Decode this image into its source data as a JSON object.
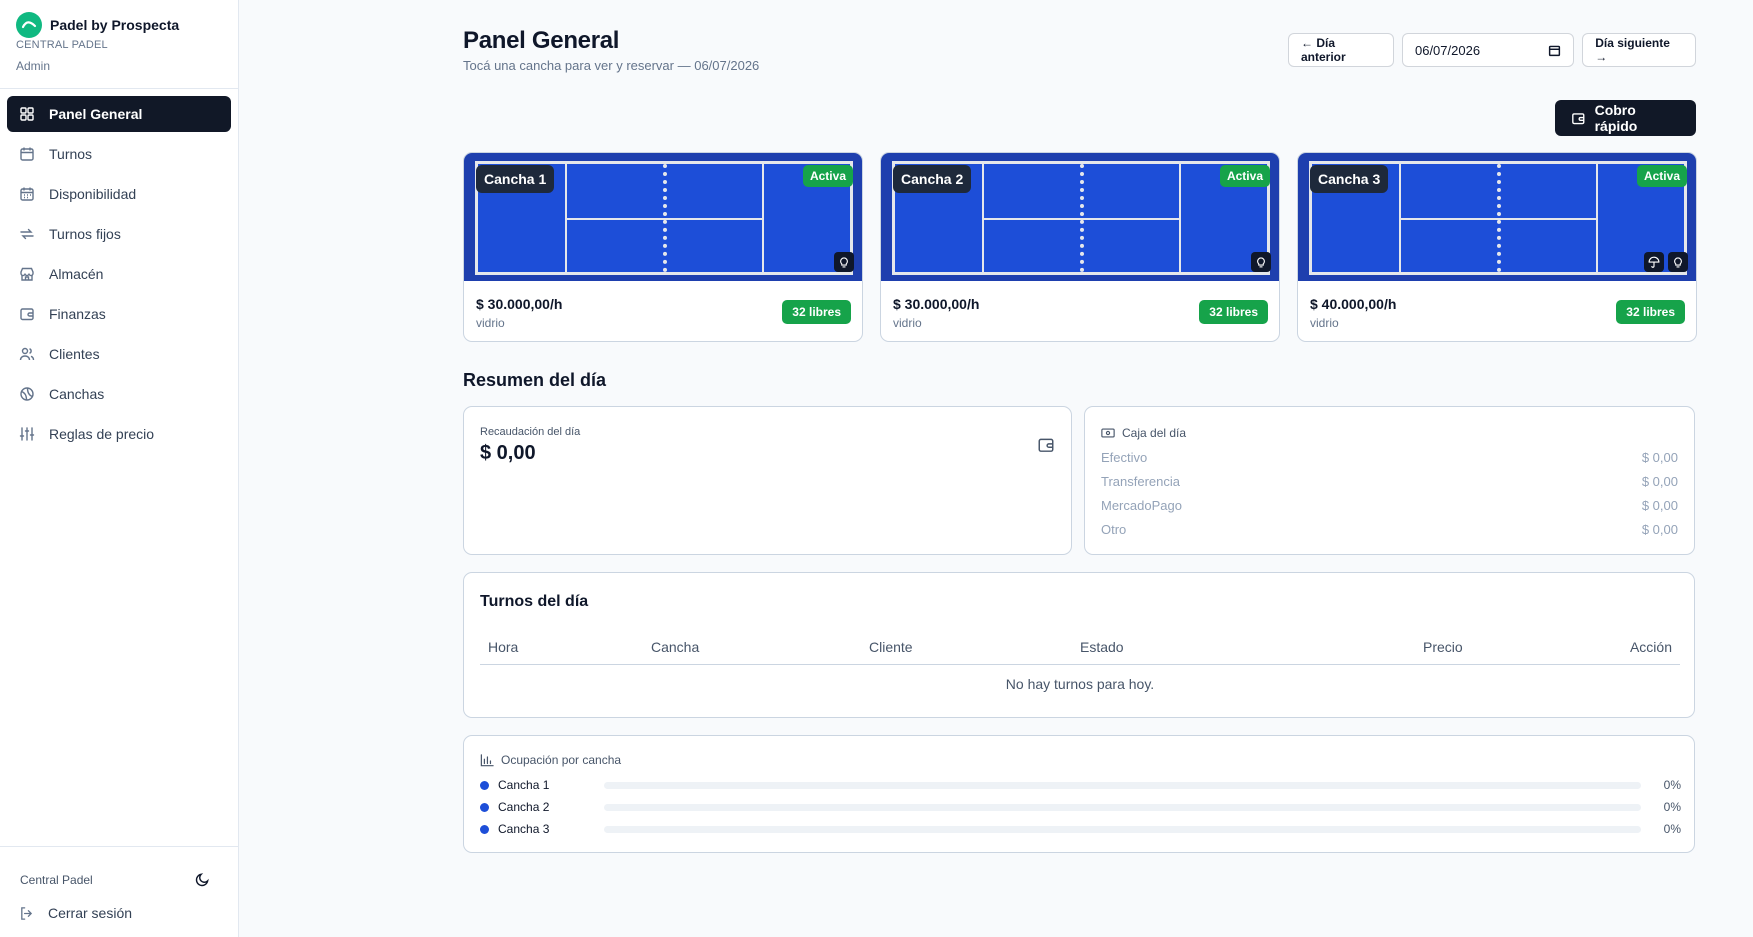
{
  "brand": {
    "name": "Padel by Prospecta",
    "club": "CENTRAL PADEL",
    "role": "Admin"
  },
  "nav": {
    "items": [
      {
        "label": "Panel General",
        "icon": "grid-icon",
        "active": true
      },
      {
        "label": "Turnos",
        "icon": "calendar-icon"
      },
      {
        "label": "Disponibilidad",
        "icon": "calendar-days-icon"
      },
      {
        "label": "Turnos fijos",
        "icon": "repeat-icon"
      },
      {
        "label": "Almacén",
        "icon": "store-icon"
      },
      {
        "label": "Finanzas",
        "icon": "wallet-icon"
      },
      {
        "label": "Clientes",
        "icon": "users-icon"
      },
      {
        "label": "Canchas",
        "icon": "ball-icon"
      },
      {
        "label": "Reglas de precio",
        "icon": "sliders-icon"
      }
    ]
  },
  "footer": {
    "club": "Central Padel",
    "logout": "Cerrar sesión"
  },
  "header": {
    "title": "Panel General",
    "subtitle": "Tocá una cancha para ver y reservar — 06/07/2026",
    "prev_label": "← Día anterior",
    "date_value": "06/07/2026",
    "next_label": "Día siguiente →",
    "quick_charge": "Cobro rápido"
  },
  "courts": [
    {
      "name": "Cancha 1",
      "status": "Activa",
      "price": "$ 30.000,00/h",
      "type": "vidrio",
      "free": "32 libres",
      "icons": [
        "lightbulb-icon"
      ]
    },
    {
      "name": "Cancha 2",
      "status": "Activa",
      "price": "$ 30.000,00/h",
      "type": "vidrio",
      "free": "32 libres",
      "icons": [
        "lightbulb-icon"
      ]
    },
    {
      "name": "Cancha 3",
      "status": "Activa",
      "price": "$ 40.000,00/h",
      "type": "vidrio",
      "free": "32 libres",
      "icons": [
        "umbrella-icon",
        "lightbulb-icon"
      ]
    }
  ],
  "summary": {
    "title": "Resumen del día",
    "collection_label": "Recaudación del día",
    "collection_value": "$ 0,00",
    "cash_title": "Caja del día",
    "cash_rows": [
      {
        "label": "Efectivo",
        "value": "$ 0,00"
      },
      {
        "label": "Transferencia",
        "value": "$ 0,00"
      },
      {
        "label": "MercadoPago",
        "value": "$ 0,00"
      },
      {
        "label": "Otro",
        "value": "$ 0,00"
      }
    ]
  },
  "bookings": {
    "title": "Turnos del día",
    "columns": [
      "Hora",
      "Cancha",
      "Cliente",
      "Estado",
      "Precio",
      "Acción"
    ],
    "empty": "No hay turnos para hoy."
  },
  "occupancy": {
    "title": "Ocupación por cancha",
    "rows": [
      {
        "name": "Cancha 1",
        "pct": "0%",
        "value": 0
      },
      {
        "name": "Cancha 2",
        "pct": "0%",
        "value": 0
      },
      {
        "name": "Cancha 3",
        "pct": "0%",
        "value": 0
      }
    ]
  },
  "colors": {
    "accent": "#111827",
    "court": "#1d4ed8",
    "success": "#16a34a",
    "brand": "#10b981"
  }
}
